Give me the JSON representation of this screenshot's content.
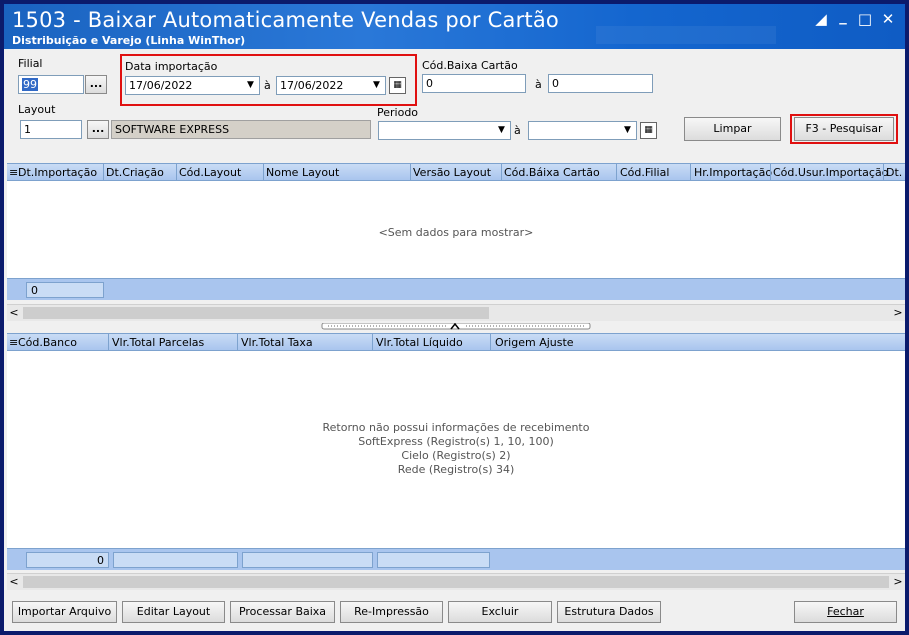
{
  "window": {
    "title": "1503 - Baixar Automaticamente Vendas por Cartão",
    "subtitle": "Distribuição e Varejo (Linha WinThor)",
    "controls": [
      "restore-icon",
      "minimize-icon",
      "maximize-icon",
      "close-icon"
    ]
  },
  "filters": {
    "filial_label": "Filial",
    "filial_value": "99",
    "data_importacao_label": "Data importação",
    "data_inicio": "17/06/2022",
    "ate_label_1": "à",
    "data_fim": "17/06/2022",
    "cod_baixa_label": "Cód.Baixa Cartão",
    "cod_baixa_inicio": "0",
    "ate_label_2": "à",
    "cod_baixa_fim": "0",
    "layout_label": "Layout",
    "layout_value": "1",
    "layout_name": "SOFTWARE EXPRESS",
    "periodo_label": "Periodo",
    "periodo_inicio": "",
    "ate_label_3": "à",
    "periodo_fim": "",
    "limpar_label": "Limpar",
    "pesquisar_label": "F3 - Pesquisar",
    "ellipsis": "..."
  },
  "grid1": {
    "columns": [
      "Dt.Importação",
      "Dt.Criação",
      "Cód.Layout",
      "Nome Layout",
      "Versão Layout",
      "Cód.Báixa Cartão",
      "Cód.Filial",
      "Hr.Importação",
      "Cód.Usur.Importação",
      "Dt."
    ],
    "empty_message": "<Sem dados para mostrar>",
    "footer_count": "0"
  },
  "grid2": {
    "columns": [
      "Cód.Banco",
      "Vlr.Total Parcelas",
      "Vlr.Total Taxa",
      "Vlr.Total Líquido",
      "Origem Ajuste"
    ],
    "empty_lines": [
      "Retorno não possui informações de recebimento",
      "SoftExpress (Registro(s) 1, 10, 100)",
      "Cielo (Registro(s) 2)",
      "Rede (Registro(s) 34)"
    ],
    "footer_count": "0"
  },
  "buttons": {
    "importar": "Importar Arquivo",
    "editar": "Editar Layout",
    "processar": "Processar Baixa",
    "reimpressao": "Re-Impressão",
    "excluir": "Excluir",
    "estrutura": "Estrutura Dados",
    "fechar": "Fechar"
  },
  "colors": {
    "title_bar": "#1a63c0",
    "grid_header": "#a9c5ee",
    "highlight": "#e01010"
  }
}
